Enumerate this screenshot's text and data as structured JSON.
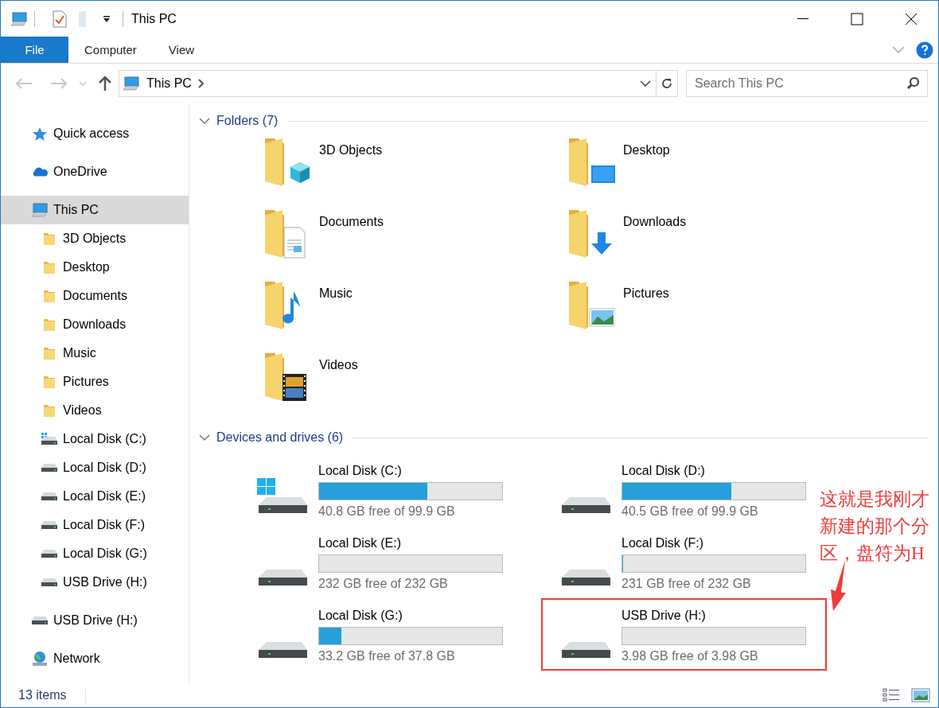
{
  "window": {
    "title": "This PC"
  },
  "ribbon": {
    "tabs": [
      {
        "label": "File",
        "kind": "file"
      },
      {
        "label": "Computer",
        "kind": "tab"
      },
      {
        "label": "View",
        "kind": "tab"
      }
    ]
  },
  "address_bar": {
    "path": [
      "This PC"
    ]
  },
  "search": {
    "placeholder": "Search This PC"
  },
  "sidebar": {
    "items": [
      {
        "label": "Quick access",
        "kind": "star",
        "selected": false
      },
      {
        "label": "OneDrive",
        "kind": "cloud",
        "selected": false
      },
      {
        "label": "This PC",
        "kind": "pc",
        "selected": true,
        "children": [
          {
            "label": "3D Objects",
            "kind": "folder",
            "selected": false
          },
          {
            "label": "Desktop",
            "kind": "folder",
            "selected": false
          },
          {
            "label": "Documents",
            "kind": "folder",
            "selected": false
          },
          {
            "label": "Downloads",
            "kind": "folder",
            "selected": false
          },
          {
            "label": "Music",
            "kind": "folder",
            "selected": false
          },
          {
            "label": "Pictures",
            "kind": "folder",
            "selected": false
          },
          {
            "label": "Videos",
            "kind": "folder",
            "selected": false
          },
          {
            "label": "Local Disk (C:)",
            "kind": "system",
            "selected": false
          },
          {
            "label": "Local Disk (D:)",
            "kind": "drive",
            "selected": false
          },
          {
            "label": "Local Disk (E:)",
            "kind": "drive",
            "selected": false
          },
          {
            "label": "Local Disk (F:)",
            "kind": "drive",
            "selected": false
          },
          {
            "label": "Local Disk (G:)",
            "kind": "drive",
            "selected": false
          },
          {
            "label": "USB Drive (H:)",
            "kind": "drive",
            "selected": false
          }
        ]
      },
      {
        "label": "USB Drive (H:)",
        "kind": "drive",
        "selected": false
      },
      {
        "label": "Network",
        "kind": "network",
        "selected": false
      }
    ]
  },
  "folders": {
    "title": "Folders (7)",
    "expanded": true,
    "items": [
      {
        "name": "3D Objects",
        "kind": "objects"
      },
      {
        "name": "Desktop",
        "kind": "desktop"
      },
      {
        "name": "Documents",
        "kind": "documents"
      },
      {
        "name": "Downloads",
        "kind": "downloads"
      },
      {
        "name": "Music",
        "kind": "music"
      },
      {
        "name": "Pictures",
        "kind": "pictures"
      },
      {
        "name": "Videos",
        "kind": "videos"
      }
    ]
  },
  "devices": {
    "title": "Devices and drives (6)",
    "expanded": true,
    "items": [
      {
        "name": "Local Disk (C:)",
        "kind": "system",
        "level": 0.59,
        "reading": "40.8 GB free of 99.9 GB",
        "highlighted": false
      },
      {
        "name": "Local Disk (D:)",
        "kind": "drive",
        "level": 0.595,
        "reading": "40.5 GB free of 99.9 GB",
        "highlighted": false
      },
      {
        "name": "Local Disk (E:)",
        "kind": "drive",
        "level": 0,
        "reading": "232 GB free of 232 GB",
        "highlighted": false
      },
      {
        "name": "Local Disk (F:)",
        "kind": "drive",
        "level": 0.004,
        "reading": "231 GB free of 232 GB",
        "highlighted": false
      },
      {
        "name": "Local Disk (G:)",
        "kind": "drive",
        "level": 0.12,
        "reading": "33.2 GB free of 37.8 GB",
        "highlighted": false
      },
      {
        "name": "USB Drive (H:)",
        "kind": "drive",
        "level": 0,
        "reading": "3.98 GB free of 3.98 GB",
        "highlighted": true
      }
    ]
  },
  "annotation": {
    "text": "这就是我刚才新建的那个分区，盘符为H"
  },
  "status_bar": {
    "text": "13 items"
  }
}
